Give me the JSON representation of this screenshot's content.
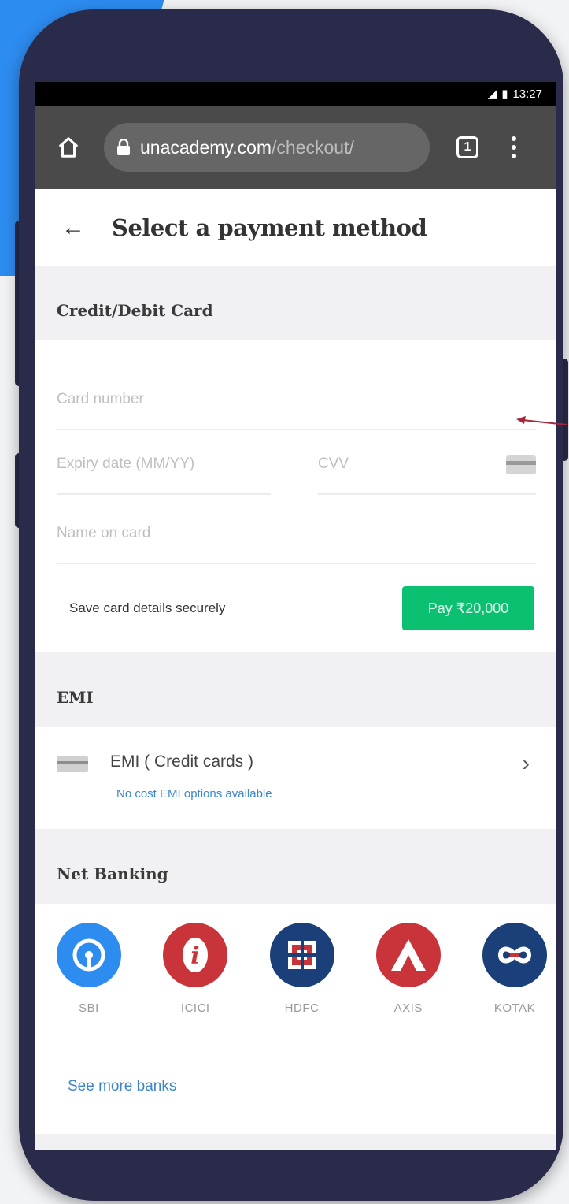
{
  "statusbar": {
    "time": "13:27",
    "signal": "◢",
    "battery": "▮"
  },
  "browser": {
    "url_domain": "unacademy.com",
    "url_path": "/checkout/",
    "tab_count": "1"
  },
  "header": {
    "title": "Select a payment method",
    "back": "←"
  },
  "card_section": {
    "heading": "Credit/Debit Card",
    "card_number_placeholder": "Card number",
    "expiry_placeholder": "Expiry date (MM/YY)",
    "cvv_placeholder": "CVV",
    "name_placeholder": "Name on card",
    "save_label": "Save card details securely",
    "pay_label": "Pay ₹20,000"
  },
  "emi_section": {
    "heading": "EMI",
    "option_title": "EMI ( Credit cards )",
    "option_subtitle": "No cost EMI options available",
    "chevron": "›"
  },
  "netbanking": {
    "heading": "Net Banking",
    "banks": [
      {
        "name": "SBI",
        "color": "#2d8cf0"
      },
      {
        "name": "ICICI",
        "color": "#c9343a"
      },
      {
        "name": "HDFC",
        "color": "#1b3f78"
      },
      {
        "name": "AXIS",
        "color": "#c9343a"
      },
      {
        "name": "KOTAK",
        "color": "#1b3f78"
      }
    ],
    "see_more": "See more banks"
  },
  "colors": {
    "accent_green": "#0cc071",
    "link_blue": "#3d87c9",
    "blob_blue": "#2d8cf0"
  }
}
